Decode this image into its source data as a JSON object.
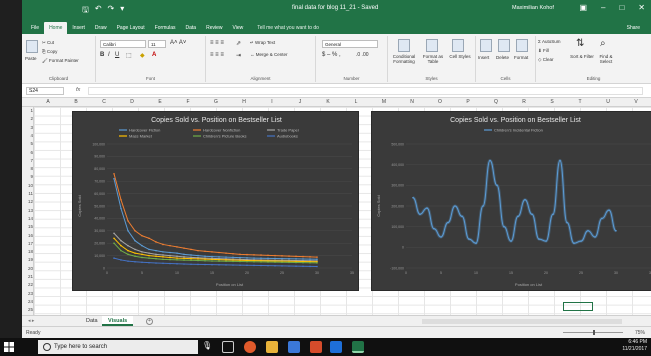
{
  "titlebar": {
    "doc_title": "final data for blog 11_21 - Saved",
    "user": "Maximilian Kohof",
    "icons": [
      "save-icon",
      "undo-icon",
      "redo-icon",
      "customize-icon"
    ]
  },
  "tabs": [
    "File",
    "Home",
    "Insert",
    "Draw",
    "Page Layout",
    "Formulas",
    "Data",
    "Review",
    "View"
  ],
  "active_tab": "Home",
  "tell_me": "Tell me what you want to do",
  "share": "Share",
  "ribbon": {
    "clipboard": {
      "paste": "Paste",
      "cut": "Cut",
      "copy": "Copy",
      "format_painter": "Format Painter",
      "label": "Clipboard"
    },
    "font": {
      "name": "Calibri",
      "size": "11",
      "label": "Font"
    },
    "alignment": {
      "wrap_text": "Wrap Text",
      "merge_center": "Merge & Center",
      "label": "Alignment"
    },
    "number": {
      "format": "General",
      "label": "Number"
    },
    "styles": {
      "conditional": "Conditional Formatting",
      "format_table": "Format as Table",
      "cell_styles": "Cell Styles",
      "label": "Styles"
    },
    "cells": {
      "insert": "Insert",
      "delete": "Delete",
      "format": "Format",
      "label": "Cells"
    },
    "editing": {
      "autosum": "AutoSum",
      "fill": "Fill",
      "clear": "Clear",
      "sort_filter": "Sort & Filter",
      "find_select": "Find & Select",
      "label": "Editing"
    }
  },
  "formula_bar": {
    "name_box": "S24",
    "fx": "fx",
    "content": ""
  },
  "columns": [
    "A",
    "B",
    "C",
    "D",
    "E",
    "F",
    "G",
    "H",
    "I",
    "J",
    "K",
    "L",
    "M",
    "N",
    "O",
    "P",
    "Q",
    "R",
    "S",
    "T",
    "U",
    "V"
  ],
  "rows": [
    "1",
    "2",
    "3",
    "4",
    "5",
    "6",
    "7",
    "8",
    "9",
    "10",
    "11",
    "12",
    "13",
    "14",
    "15",
    "16",
    "17",
    "18",
    "19",
    "20",
    "21",
    "22",
    "23",
    "24",
    "25"
  ],
  "sheets": [
    "Data",
    "Visuals"
  ],
  "active_sheet": "Visuals",
  "status": {
    "ready": "Ready",
    "zoom": "75%"
  },
  "taskbar": {
    "search_placeholder": "Type here to search",
    "time": "6:46 PM",
    "date": "11/21/2017"
  },
  "chart_data": [
    {
      "type": "line",
      "title": "Copies Sold vs. Position on Bestseller List",
      "xlabel": "Position on List",
      "ylabel": "Copies Sold",
      "ylim": [
        0,
        100000
      ],
      "xlim": [
        0,
        35
      ],
      "yticks": [
        "100,000",
        "90,000",
        "80,000",
        "70,000",
        "60,000",
        "50,000",
        "40,000",
        "30,000",
        "20,000",
        "10,000",
        "0"
      ],
      "xticks": [
        "0",
        "5",
        "10",
        "15",
        "20",
        "25",
        "30",
        "35"
      ],
      "legend_position": "top",
      "grid": true,
      "x": [
        1,
        2,
        3,
        4,
        5,
        6,
        7,
        8,
        9,
        10,
        11,
        12,
        13,
        14,
        15,
        16,
        17,
        18,
        19,
        20,
        21,
        22,
        23,
        24,
        25,
        26,
        27,
        28,
        29,
        30
      ],
      "series": [
        {
          "name": "Hardcover Fiction",
          "color": "#5b9bd5",
          "values": [
            72000,
            48000,
            30000,
            22000,
            18000,
            15000,
            14000,
            13000,
            12500,
            12000,
            11000,
            10500,
            10000,
            9500,
            9200,
            9000,
            8800,
            8600,
            8400,
            8200,
            8000,
            7900,
            7800,
            7700,
            7600,
            7500,
            7400,
            7300,
            7200,
            7100
          ]
        },
        {
          "name": "Hardcover Nonfiction",
          "color": "#ed7d31",
          "values": [
            76000,
            55000,
            38000,
            30000,
            26000,
            24000,
            21000,
            19000,
            18000,
            17000,
            16000,
            15000,
            14000,
            13500,
            13000,
            12500,
            12000,
            11500,
            11000,
            10800,
            10600,
            10400,
            10200,
            10000,
            9800,
            9600,
            9400,
            9200,
            9000,
            8800
          ]
        },
        {
          "name": "Trade Paper",
          "color": "#a5a5a5",
          "values": [
            28000,
            22000,
            18000,
            15000,
            13000,
            12000,
            11000,
            10500,
            10000,
            9500,
            9000,
            8600,
            8300,
            8000,
            7800,
            7600,
            7400,
            7200,
            7000,
            6800,
            6600,
            6500,
            6400,
            6300,
            6200,
            6100,
            6000,
            5900,
            5800,
            5700
          ]
        },
        {
          "name": "Mass Market",
          "color": "#ffc000",
          "values": [
            24000,
            18000,
            14000,
            12000,
            11000,
            10000,
            9500,
            9000,
            8500,
            8000,
            7800,
            7600,
            7400,
            7200,
            7000,
            6800,
            6600,
            6400,
            6200,
            6000,
            5900,
            5800,
            5700,
            5600,
            5500,
            5400,
            5300,
            5200,
            5100,
            5000
          ]
        },
        {
          "name": "Children's Picture Books",
          "color": "#70ad47",
          "values": [
            20000,
            14000,
            11000,
            9500,
            8500,
            8000,
            7500,
            7000,
            6800,
            6600,
            6400,
            6200,
            6000,
            5800,
            5600,
            5500,
            5400,
            5300,
            5200,
            5100,
            5000,
            4900,
            4800,
            4700,
            4600,
            4500,
            4400,
            4300,
            4200,
            4100
          ]
        },
        {
          "name": "Audiobooks",
          "color": "#4472c4",
          "values": [
            8000,
            6500,
            5500,
            5000,
            4600,
            4300,
            4000,
            3800,
            3600,
            3400,
            3200,
            3000,
            2900,
            2800,
            2700,
            2600,
            2500,
            2400,
            2300,
            2200,
            2100,
            2000,
            1900,
            1800,
            1700,
            1600,
            1500,
            1400,
            1300,
            1200
          ]
        }
      ]
    },
    {
      "type": "line",
      "title": "Copies Sold vs. Position on Bestseller List",
      "xlabel": "Position on List",
      "ylabel": "Copies Sold",
      "ylim": [
        -100000,
        500000
      ],
      "xlim": [
        0,
        35
      ],
      "yticks": [
        "500,000",
        "400,000",
        "300,000",
        "200,000",
        "100,000",
        "0",
        "-100,000"
      ],
      "xticks": [
        "0",
        "5",
        "10",
        "15",
        "20",
        "25",
        "30",
        "35"
      ],
      "legend_position": "top",
      "grid": true,
      "x": [
        1,
        2,
        3,
        4,
        5,
        6,
        7,
        8,
        9,
        10,
        11,
        12,
        13,
        14,
        15,
        16,
        17,
        18,
        19,
        20,
        21,
        22,
        23,
        24,
        25,
        26,
        27,
        28,
        29,
        30
      ],
      "series": [
        {
          "name": "Children's Incidental Fiction",
          "color": "#5b9bd5",
          "values": [
            240000,
            160000,
            190000,
            90000,
            50000,
            120000,
            200000,
            150000,
            40000,
            20000,
            200000,
            420000,
            300000,
            100000,
            30000,
            150000,
            230000,
            160000,
            40000,
            30000,
            160000,
            420000,
            120000,
            20000,
            30000,
            80000,
            50000,
            140000,
            180000,
            80000
          ]
        }
      ]
    }
  ]
}
